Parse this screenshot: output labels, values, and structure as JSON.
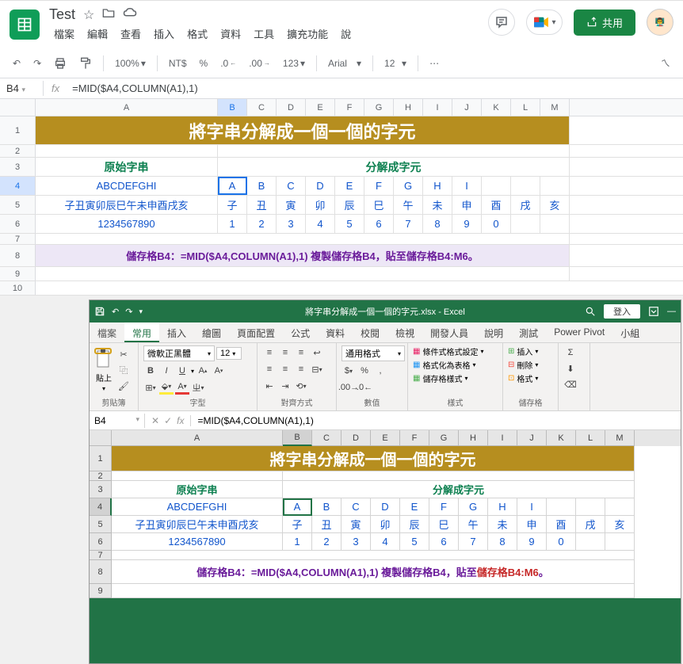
{
  "gs": {
    "title": "Test",
    "menu": [
      "檔案",
      "編輯",
      "查看",
      "插入",
      "格式",
      "資料",
      "工具",
      "擴充功能",
      "說"
    ],
    "share_label": "共用",
    "toolbar": {
      "zoom": "100%",
      "currency": "NT$",
      "percent": "%",
      "dec_dec": ".0",
      "dec_inc": ".00",
      "num_format": "123",
      "font": "Arial",
      "font_size": "12"
    },
    "cell_ref": "B4",
    "formula": "=MID($A4,COLUMN(A1),1)",
    "cols": [
      "A",
      "B",
      "C",
      "D",
      "E",
      "F",
      "G",
      "H",
      "I",
      "J",
      "K",
      "L",
      "M"
    ],
    "row_title": "將字串分解成一個一個的字元",
    "header_a": "原始字串",
    "header_b": "分解成字元",
    "r4": {
      "a": "ABCDEFGHI",
      "cells": [
        "A",
        "B",
        "C",
        "D",
        "E",
        "F",
        "G",
        "H",
        "I",
        "",
        "",
        ""
      ]
    },
    "r5": {
      "a": "子丑寅卯辰巳午未申酉戌亥",
      "cells": [
        "子",
        "丑",
        "寅",
        "卯",
        "辰",
        "巳",
        "午",
        "未",
        "申",
        "酉",
        "戌",
        "亥"
      ]
    },
    "r6": {
      "a": "1234567890",
      "cells": [
        "1",
        "2",
        "3",
        "4",
        "5",
        "6",
        "7",
        "8",
        "9",
        "0",
        "",
        ""
      ]
    },
    "r8": "儲存格B4：=MID($A4,COLUMN(A1),1) 複製儲存格B4，貼至儲存格B4:M6。"
  },
  "excel": {
    "title": "將字串分解成一個一個的字元.xlsx - Excel",
    "signin": "登入",
    "tabs": [
      "檔案",
      "常用",
      "插入",
      "繪圖",
      "頁面配置",
      "公式",
      "資料",
      "校閱",
      "檢視",
      "開發人員",
      "說明",
      "測試",
      "Power Pivot",
      "小組"
    ],
    "ribbon": {
      "clipboard": {
        "paste": "貼上",
        "label": "剪貼簿"
      },
      "font": {
        "name": "微軟正黑體",
        "size": "12",
        "label": "字型"
      },
      "align": {
        "label": "對齊方式"
      },
      "number": {
        "format": "通用格式",
        "label": "數值"
      },
      "styles": {
        "cond": "條件式格式設定",
        "table": "格式化為表格",
        "cell": "儲存格樣式",
        "label": "樣式"
      },
      "cells": {
        "insert": "插入",
        "delete": "刪除",
        "format": "格式",
        "label": "儲存格"
      }
    },
    "namebox": "B4",
    "formula": "=MID($A4,COLUMN(A1),1)",
    "cols": [
      "A",
      "B",
      "C",
      "D",
      "E",
      "F",
      "G",
      "H",
      "I",
      "J",
      "K",
      "L",
      "M"
    ],
    "row_title": "將字串分解成一個一個的字元",
    "header_a": "原始字串",
    "header_b": "分解成字元",
    "r4": {
      "a": "ABCDEFGHI",
      "cells": [
        "A",
        "B",
        "C",
        "D",
        "E",
        "F",
        "G",
        "H",
        "I",
        "",
        "",
        ""
      ]
    },
    "r5": {
      "a": "子丑寅卯辰巳午未申酉戌亥",
      "cells": [
        "子",
        "丑",
        "寅",
        "卯",
        "辰",
        "巳",
        "午",
        "未",
        "申",
        "酉",
        "戌",
        "亥"
      ]
    },
    "r6": {
      "a": "1234567890",
      "cells": [
        "1",
        "2",
        "3",
        "4",
        "5",
        "6",
        "7",
        "8",
        "9",
        "0",
        "",
        ""
      ]
    },
    "r8_a": "儲存格B4：=MID($A4,COLUMN(A1),1)  複製儲存格B4，貼至",
    "r8_b": "儲存格B4:M6",
    "r8_c": "。"
  }
}
